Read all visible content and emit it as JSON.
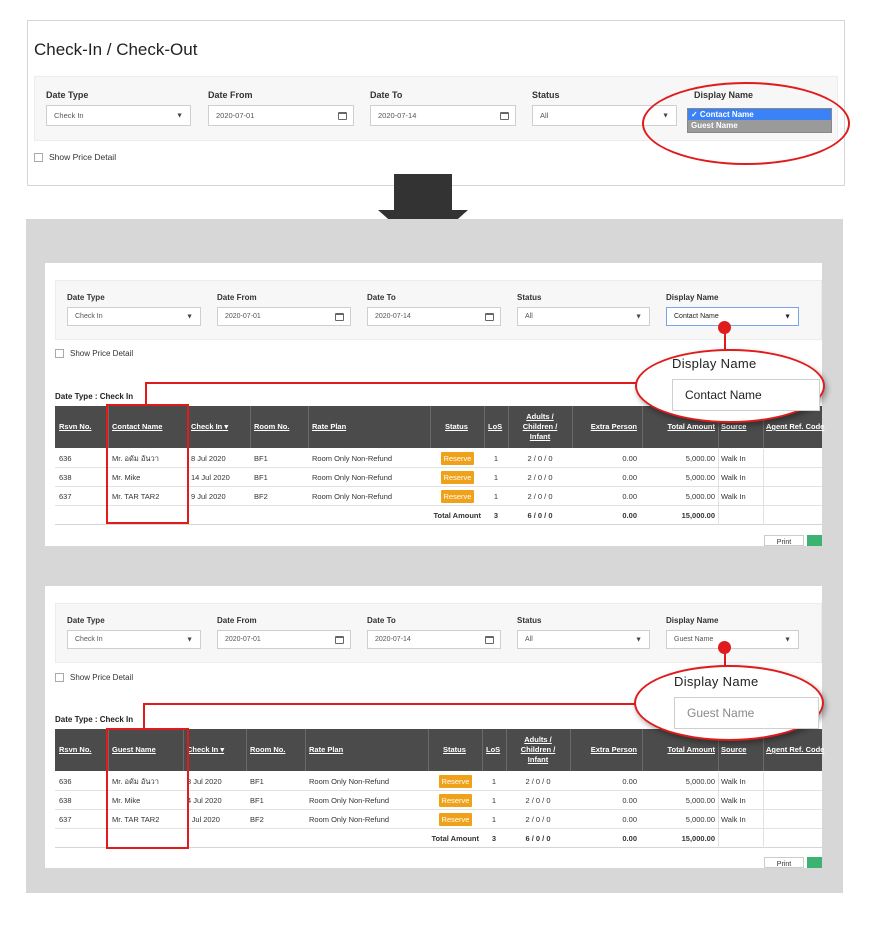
{
  "top": {
    "title": "Check-In / Check-Out",
    "filters": {
      "date_type_label": "Date Type",
      "date_type_value": "Check In",
      "date_from_label": "Date From",
      "date_from_value": "2020-07-01",
      "date_to_label": "Date To",
      "date_to_value": "2020-07-14",
      "status_label": "Status",
      "status_value": "All",
      "display_name_label": "Display Name"
    },
    "dropdown_options": [
      "✓ Contact Name",
      "Guest Name"
    ],
    "show_price_detail": "Show Price Detail"
  },
  "panels": {
    "contact": {
      "filters": {
        "date_type_label": "Date Type",
        "date_type_value": "Check In",
        "date_from_label": "Date From",
        "date_from_value": "2020-07-01",
        "date_to_label": "Date To",
        "date_to_value": "2020-07-14",
        "status_label": "Status",
        "status_value": "All",
        "display_name_label": "Display Name",
        "display_name_value": "Contact Name"
      },
      "show_price_detail": "Show Price Detail",
      "date_type_heading": "Date Type : Check In",
      "headers": {
        "rsvn": "Rsvn No.",
        "name": "Contact Name",
        "checkin": "Check In",
        "room": "Room No.",
        "plan": "Rate Plan",
        "status": "Status",
        "los": "LoS",
        "adults_1": "Adults /",
        "adults_2": "Children /",
        "adults_3": "Infant",
        "extra": "Extra Person",
        "total": "Total Amount",
        "source": "Source",
        "agent": "Agent Ref. Code"
      },
      "rows": [
        {
          "rsvn": "636",
          "name": "Mr. อดัม อันวา",
          "checkin": "8 Jul 2020",
          "room": "BF1",
          "plan": "Room Only Non-Refund",
          "status": "Reserve",
          "los": "1",
          "acl": "2 / 0 / 0",
          "extra": "0.00",
          "total": "5,000.00",
          "source": "Walk In"
        },
        {
          "rsvn": "638",
          "name": "Mr. Mike",
          "checkin": "14 Jul 2020",
          "room": "BF1",
          "plan": "Room Only Non-Refund",
          "status": "Reserve",
          "los": "1",
          "acl": "2 / 0 / 0",
          "extra": "0.00",
          "total": "5,000.00",
          "source": "Walk In"
        },
        {
          "rsvn": "637",
          "name": "Mr. TAR TAR2",
          "checkin": "9 Jul 2020",
          "room": "BF2",
          "plan": "Room Only Non-Refund",
          "status": "Reserve",
          "los": "1",
          "acl": "2 / 0 / 0",
          "extra": "0.00",
          "total": "5,000.00",
          "source": "Walk In"
        }
      ],
      "totals": {
        "label": "Total Amount",
        "los": "3",
        "acl": "6 / 0 / 0",
        "extra": "0.00",
        "total": "15,000.00"
      },
      "print_label": "Print",
      "callout": {
        "label": "Display Name",
        "value": "Contact Name"
      }
    },
    "guest": {
      "filters": {
        "date_type_label": "Date Type",
        "date_type_value": "Check In",
        "date_from_label": "Date From",
        "date_from_value": "2020-07-01",
        "date_to_label": "Date To",
        "date_to_value": "2020-07-14",
        "status_label": "Status",
        "status_value": "All",
        "display_name_label": "Display Name",
        "display_name_value": "Guest Name"
      },
      "show_price_detail": "Show Price Detail",
      "date_type_heading": "Date Type : Check In",
      "headers": {
        "rsvn": "Rsvn No.",
        "name": "Guest Name",
        "checkin": "Check In",
        "room": "Room No.",
        "plan": "Rate Plan",
        "status": "Status",
        "los": "LoS",
        "adults_1": "Adults /",
        "adults_2": "Children /",
        "adults_3": "Infant",
        "extra": "Extra Person",
        "total": "Total Amount",
        "source": "Source",
        "agent": "Agent Ref. Code"
      },
      "rows": [
        {
          "rsvn": "636",
          "name": "Mr. อดัม อันวา",
          "checkin": "3 Jul 2020",
          "room": "BF1",
          "plan": "Room Only Non-Refund",
          "status": "Reserve",
          "los": "1",
          "acl": "2 / 0 / 0",
          "extra": "0.00",
          "total": "5,000.00",
          "source": "Walk In"
        },
        {
          "rsvn": "638",
          "name": "Mr. Mike",
          "checkin": "4 Jul 2020",
          "room": "BF1",
          "plan": "Room Only Non-Refund",
          "status": "Reserve",
          "los": "1",
          "acl": "2 / 0 / 0",
          "extra": "0.00",
          "total": "5,000.00",
          "source": "Walk In"
        },
        {
          "rsvn": "637",
          "name": "Mr. TAR TAR2",
          "checkin": ") Jul 2020",
          "room": "BF2",
          "plan": "Room Only Non-Refund",
          "status": "Reserve",
          "los": "1",
          "acl": "2 / 0 / 0",
          "extra": "0.00",
          "total": "5,000.00",
          "source": "Walk In"
        }
      ],
      "totals": {
        "label": "Total Amount",
        "los": "3",
        "acl": "6 / 0 / 0",
        "extra": "0.00",
        "total": "15,000.00"
      },
      "print_label": "Print",
      "callout": {
        "label": "Display Name",
        "value": "Guest Name"
      }
    }
  },
  "colors": {
    "highlight": "#e01b1b",
    "reserve": "#f0a11a",
    "table_header": "#4b4b4b",
    "selected_option": "#3b82f6"
  }
}
